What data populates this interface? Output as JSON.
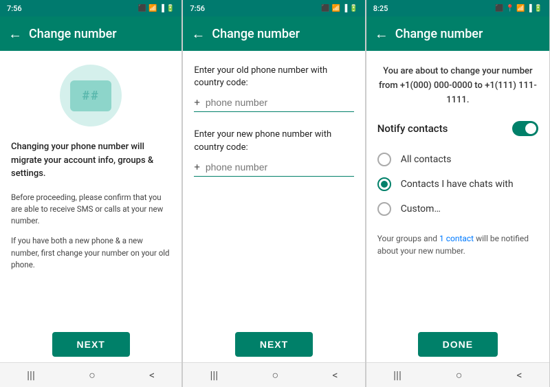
{
  "panel1": {
    "time": "7:56",
    "title": "Change number",
    "desc": "Changing your phone number will migrate your account info, groups & settings.",
    "note1": "Before proceeding, please confirm that you are able to receive SMS or calls at your new number.",
    "note2": "If you have both a new phone & a new number, first change your number on your old phone.",
    "next_label": "NEXT"
  },
  "panel2": {
    "time": "7:56",
    "title": "Change number",
    "old_label": "Enter your old phone number with country code:",
    "old_placeholder": "phone number",
    "new_label": "Enter your new phone number with country code:",
    "new_placeholder": "phone number",
    "next_label": "NEXT"
  },
  "panel3": {
    "time": "8:25",
    "title": "Change number",
    "notice_prefix": "You are about to change your number from ",
    "old_number": "+1(000) 000-0000",
    "notice_mid": " to ",
    "new_number": "+1(111) 111-1111",
    "notice_suffix": ".",
    "notify_label": "Notify contacts",
    "radio_options": [
      {
        "label": "All contacts",
        "selected": false
      },
      {
        "label": "Contacts I have chats with",
        "selected": true
      },
      {
        "label": "Custom…",
        "selected": false
      }
    ],
    "groups_notice_prefix": "Your groups and ",
    "groups_notice_link": "1 contact",
    "groups_notice_suffix": " will be notified about your new number.",
    "done_label": "DONE"
  },
  "nav": {
    "menu_icon": "|||",
    "home_icon": "○",
    "back_icon": "<"
  }
}
